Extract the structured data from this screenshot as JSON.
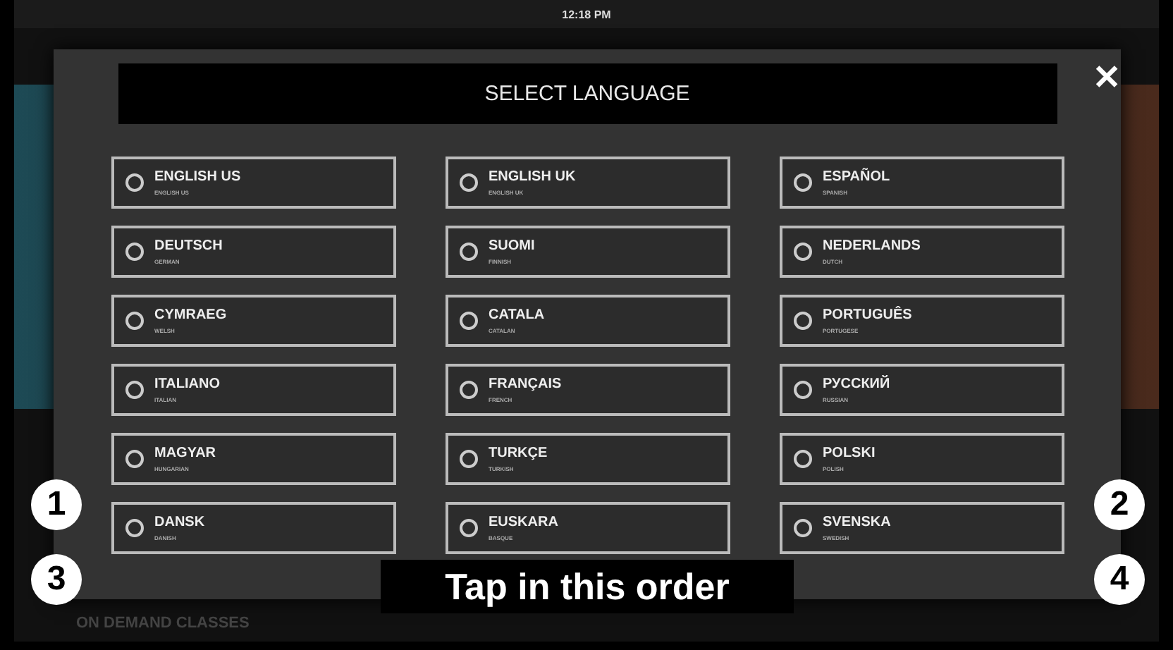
{
  "status_bar": {
    "time": "12:18 PM"
  },
  "background": {
    "section_title": "ON DEMAND CLASSES"
  },
  "dialog": {
    "title": "SELECT LANGUAGE",
    "close": "✕",
    "languages": [
      {
        "name": "ENGLISH US",
        "subtitle": "ENGLISH US",
        "selected": false
      },
      {
        "name": "ENGLISH UK",
        "subtitle": "ENGLISH UK",
        "selected": false
      },
      {
        "name": "ESPAÑOL",
        "subtitle": "SPANISH",
        "selected": false
      },
      {
        "name": "DEUTSCH",
        "subtitle": "GERMAN",
        "selected": false
      },
      {
        "name": "SUOMI",
        "subtitle": "FINNISH",
        "selected": false
      },
      {
        "name": "NEDERLANDS",
        "subtitle": "DUTCH",
        "selected": false
      },
      {
        "name": "CYMRAEG",
        "subtitle": "WELSH",
        "selected": false
      },
      {
        "name": "CATALA",
        "subtitle": "CATALAN",
        "selected": false
      },
      {
        "name": "PORTUGUÊS",
        "subtitle": "PORTUGESE",
        "selected": false
      },
      {
        "name": "ITALIANO",
        "subtitle": "ITALIAN",
        "selected": false
      },
      {
        "name": "FRANÇAIS",
        "subtitle": "FRENCH",
        "selected": false
      },
      {
        "name": "РУССКИЙ",
        "subtitle": "RUSSIAN",
        "selected": false
      },
      {
        "name": "MAGYAR",
        "subtitle": "HUNGARIAN",
        "selected": false
      },
      {
        "name": "TURKÇE",
        "subtitle": "TURKISH",
        "selected": false
      },
      {
        "name": "POLSKI",
        "subtitle": "POLISH",
        "selected": false
      },
      {
        "name": "DANSK",
        "subtitle": "DANISH",
        "selected": false
      },
      {
        "name": "EUSKARA",
        "subtitle": "BASQUE",
        "selected": false
      },
      {
        "name": "SVENSKA",
        "subtitle": "SWEDISH",
        "selected": false
      }
    ]
  },
  "annotation": {
    "markers": [
      "1",
      "2",
      "3",
      "4"
    ],
    "caption": "Tap in this order"
  }
}
